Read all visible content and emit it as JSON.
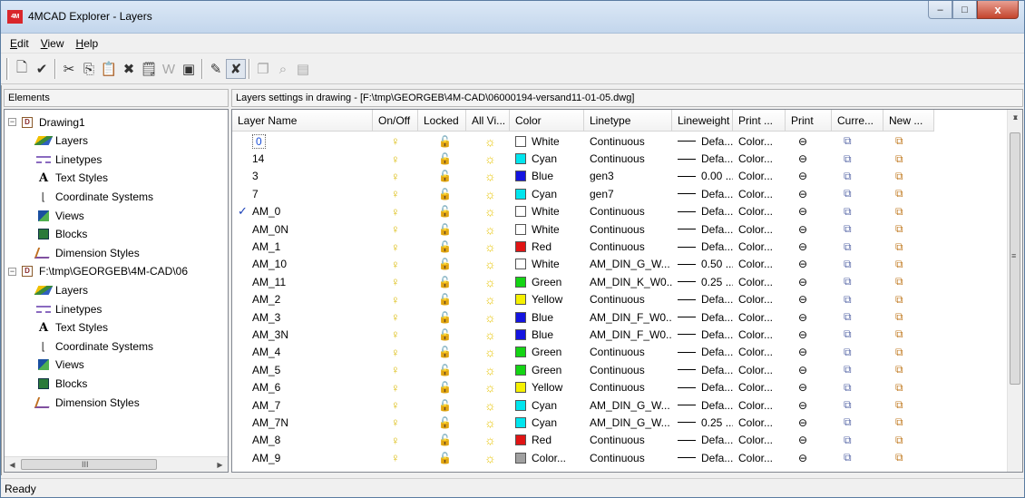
{
  "window": {
    "title": "4MCAD Explorer - Layers",
    "app_icon_text": "4M",
    "minimize_glyph": "–",
    "maximize_glyph": "□",
    "close_glyph": "x"
  },
  "menu": [
    {
      "label_key": "E",
      "label_rest": "dit"
    },
    {
      "label_key": "V",
      "label_rest": "iew"
    },
    {
      "label_key": "H",
      "label_rest": "elp"
    }
  ],
  "left_panel": {
    "header": "Elements",
    "tree": [
      {
        "label": "Drawing1",
        "level": 0,
        "toggle": "−",
        "icon": "drawing-icon"
      },
      {
        "label": "Layers",
        "level": 1,
        "icon": "layers-icon"
      },
      {
        "label": "Linetypes",
        "level": 1,
        "icon": "linetypes-icon"
      },
      {
        "label": "Text Styles",
        "level": 1,
        "icon": "text-styles-icon"
      },
      {
        "label": "Coordinate Systems",
        "level": 1,
        "icon": "coordinate-systems-icon"
      },
      {
        "label": "Views",
        "level": 1,
        "icon": "views-icon"
      },
      {
        "label": "Blocks",
        "level": 1,
        "icon": "blocks-icon"
      },
      {
        "label": "Dimension Styles",
        "level": 1,
        "icon": "dimension-styles-icon"
      },
      {
        "label": "F:\\tmp\\GEORGEB\\4M-CAD\\06",
        "level": 0,
        "toggle": "−",
        "icon": "drawing-icon"
      },
      {
        "label": "Layers",
        "level": 1,
        "icon": "layers-icon"
      },
      {
        "label": "Linetypes",
        "level": 1,
        "icon": "linetypes-icon"
      },
      {
        "label": "Text Styles",
        "level": 1,
        "icon": "text-styles-icon"
      },
      {
        "label": "Coordinate Systems",
        "level": 1,
        "icon": "coordinate-systems-icon"
      },
      {
        "label": "Views",
        "level": 1,
        "icon": "views-icon"
      },
      {
        "label": "Blocks",
        "level": 1,
        "icon": "blocks-icon"
      },
      {
        "label": "Dimension Styles",
        "level": 1,
        "icon": "dimension-styles-icon"
      }
    ],
    "hscroll_grip": "III"
  },
  "right_panel": {
    "header": "Layers settings in drawing - [F:\\tmp\\GEORGEB\\4M-CAD\\06000194-versand11-01-05.dwg]",
    "columns": [
      "Layer Name",
      "On/Off",
      "Locked",
      "All Vi...",
      "Color",
      "Linetype",
      "Lineweight",
      "Print ...",
      "Print",
      "Curre...",
      "New ..."
    ],
    "rows": [
      {
        "name": "0",
        "current": false,
        "selected": true,
        "color": "White",
        "color_hex": "#ffffff",
        "linetype": "Continuous",
        "lineweight": "Defa...",
        "plotstyle": "Color..."
      },
      {
        "name": "14",
        "current": false,
        "selected": false,
        "color": "Cyan",
        "color_hex": "#00e5ee",
        "linetype": "Continuous",
        "lineweight": "Defa...",
        "plotstyle": "Color..."
      },
      {
        "name": "3",
        "current": false,
        "selected": false,
        "color": "Blue",
        "color_hex": "#1414e0",
        "linetype": "gen3",
        "lineweight": "0.00 ...",
        "plotstyle": "Color..."
      },
      {
        "name": "7",
        "current": false,
        "selected": false,
        "color": "Cyan",
        "color_hex": "#00e5ee",
        "linetype": "gen7",
        "lineweight": "Defa...",
        "plotstyle": "Color..."
      },
      {
        "name": "AM_0",
        "current": true,
        "selected": false,
        "color": "White",
        "color_hex": "#ffffff",
        "linetype": "Continuous",
        "lineweight": "Defa...",
        "plotstyle": "Color..."
      },
      {
        "name": "AM_0N",
        "current": false,
        "selected": false,
        "color": "White",
        "color_hex": "#ffffff",
        "linetype": "Continuous",
        "lineweight": "Defa...",
        "plotstyle": "Color..."
      },
      {
        "name": "AM_1",
        "current": false,
        "selected": false,
        "color": "Red",
        "color_hex": "#e01414",
        "linetype": "Continuous",
        "lineweight": "Defa...",
        "plotstyle": "Color..."
      },
      {
        "name": "AM_10",
        "current": false,
        "selected": false,
        "color": "White",
        "color_hex": "#ffffff",
        "linetype": "AM_DIN_G_W...",
        "lineweight": "0.50 ...",
        "plotstyle": "Color..."
      },
      {
        "name": "AM_11",
        "current": false,
        "selected": false,
        "color": "Green",
        "color_hex": "#14d414",
        "linetype": "AM_DIN_K_W0...",
        "lineweight": "0.25 ...",
        "plotstyle": "Color..."
      },
      {
        "name": "AM_2",
        "current": false,
        "selected": false,
        "color": "Yellow",
        "color_hex": "#f5f000",
        "linetype": "Continuous",
        "lineweight": "Defa...",
        "plotstyle": "Color..."
      },
      {
        "name": "AM_3",
        "current": false,
        "selected": false,
        "color": "Blue",
        "color_hex": "#1414e0",
        "linetype": "AM_DIN_F_W0...",
        "lineweight": "Defa...",
        "plotstyle": "Color..."
      },
      {
        "name": "AM_3N",
        "current": false,
        "selected": false,
        "color": "Blue",
        "color_hex": "#1414e0",
        "linetype": "AM_DIN_F_W0...",
        "lineweight": "Defa...",
        "plotstyle": "Color..."
      },
      {
        "name": "AM_4",
        "current": false,
        "selected": false,
        "color": "Green",
        "color_hex": "#14d414",
        "linetype": "Continuous",
        "lineweight": "Defa...",
        "plotstyle": "Color..."
      },
      {
        "name": "AM_5",
        "current": false,
        "selected": false,
        "color": "Green",
        "color_hex": "#14d414",
        "linetype": "Continuous",
        "lineweight": "Defa...",
        "plotstyle": "Color..."
      },
      {
        "name": "AM_6",
        "current": false,
        "selected": false,
        "color": "Yellow",
        "color_hex": "#f5f000",
        "linetype": "Continuous",
        "lineweight": "Defa...",
        "plotstyle": "Color..."
      },
      {
        "name": "AM_7",
        "current": false,
        "selected": false,
        "color": "Cyan",
        "color_hex": "#00e5ee",
        "linetype": "AM_DIN_G_W...",
        "lineweight": "Defa...",
        "plotstyle": "Color..."
      },
      {
        "name": "AM_7N",
        "current": false,
        "selected": false,
        "color": "Cyan",
        "color_hex": "#00e5ee",
        "linetype": "AM_DIN_G_W...",
        "lineweight": "0.25 ...",
        "plotstyle": "Color..."
      },
      {
        "name": "AM_8",
        "current": false,
        "selected": false,
        "color": "Red",
        "color_hex": "#e01414",
        "linetype": "Continuous",
        "lineweight": "Defa...",
        "plotstyle": "Color..."
      },
      {
        "name": "AM_9",
        "current": false,
        "selected": false,
        "color": "Color...",
        "color_hex": "#a0a0a0",
        "linetype": "Continuous",
        "lineweight": "Defa...",
        "plotstyle": "Color..."
      }
    ]
  },
  "toolbar": {
    "buttons": [
      {
        "name": "new-item-button",
        "icon": "new-document-icon",
        "glyph": "🗋",
        "pressed": false,
        "disabled": false
      },
      {
        "name": "check-button",
        "icon": "check-icon",
        "glyph": "✔",
        "pressed": false,
        "disabled": false
      },
      {
        "sep": true
      },
      {
        "name": "cut-button",
        "icon": "scissors-icon",
        "glyph": "✂",
        "pressed": false,
        "disabled": false
      },
      {
        "name": "copy-button",
        "icon": "copy-icon",
        "glyph": "⎘",
        "pressed": false,
        "disabled": false
      },
      {
        "name": "paste-button",
        "icon": "paste-icon",
        "glyph": "📋",
        "pressed": false,
        "disabled": false
      },
      {
        "name": "delete-button",
        "icon": "delete-x-icon",
        "glyph": "✖",
        "pressed": false,
        "disabled": false
      },
      {
        "name": "properties-button",
        "icon": "properties-icon",
        "glyph": "🗒",
        "pressed": false,
        "disabled": false
      },
      {
        "name": "w-button",
        "icon": "w-icon",
        "glyph": "W",
        "pressed": false,
        "disabled": true
      },
      {
        "name": "view-button",
        "icon": "view-icon",
        "glyph": "▣",
        "pressed": false,
        "disabled": false
      },
      {
        "sep": true
      },
      {
        "name": "edit-layer-button",
        "icon": "edit-layer-icon",
        "glyph": "✎",
        "pressed": false,
        "disabled": false
      },
      {
        "name": "purge-button",
        "icon": "purge-icon",
        "glyph": "✘",
        "pressed": true,
        "disabled": false
      },
      {
        "sep": true
      },
      {
        "name": "tool-a-button",
        "icon": "doc-icon",
        "glyph": "❐",
        "pressed": false,
        "disabled": true
      },
      {
        "name": "tool-b-button",
        "icon": "search-icon",
        "glyph": "⌕",
        "pressed": false,
        "disabled": true
      },
      {
        "name": "tool-c-button",
        "icon": "save-icon",
        "glyph": "▤",
        "pressed": false,
        "disabled": true
      }
    ]
  },
  "status": {
    "text": "Ready"
  },
  "colors": {
    "selection_text": "#1b4fd8",
    "current_check": "#1a3fb8"
  }
}
